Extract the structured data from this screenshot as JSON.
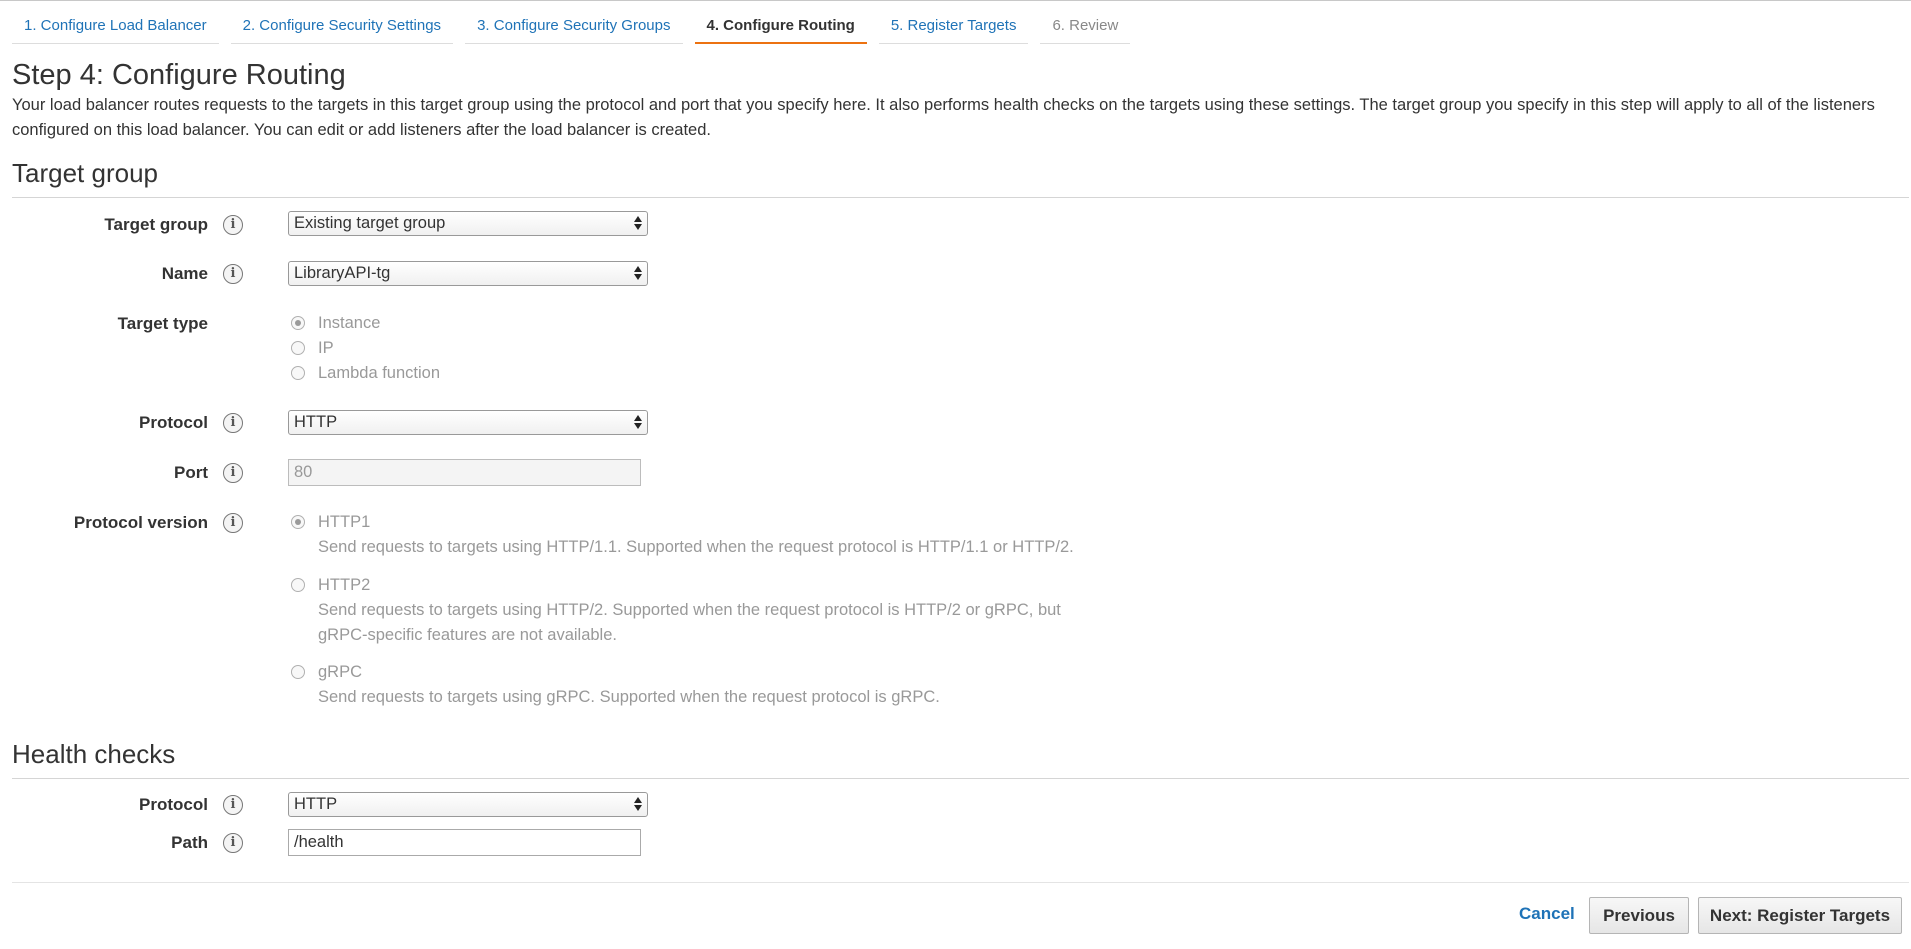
{
  "wizard": {
    "tabs": [
      {
        "label": "1. Configure Load Balancer",
        "state": "link"
      },
      {
        "label": "2. Configure Security Settings",
        "state": "link"
      },
      {
        "label": "3. Configure Security Groups",
        "state": "link"
      },
      {
        "label": "4. Configure Routing",
        "state": "active"
      },
      {
        "label": "5. Register Targets",
        "state": "link"
      },
      {
        "label": "6. Review",
        "state": "disabled"
      }
    ]
  },
  "page": {
    "title": "Step 4: Configure Routing",
    "description": "Your load balancer routes requests to the targets in this target group using the protocol and port that you specify here. It also performs health checks on the targets using these settings. The target group you specify in this step will apply to all of the listeners configured on this load balancer. You can edit or add listeners after the load balancer is created."
  },
  "target_group": {
    "section_title": "Target group",
    "target_group_label": "Target group",
    "target_group_value": "Existing target group",
    "name_label": "Name",
    "name_value": "LibraryAPI-tg",
    "target_type_label": "Target type",
    "target_type_options": [
      "Instance",
      "IP",
      "Lambda function"
    ],
    "target_type_selected": "Instance",
    "protocol_label": "Protocol",
    "protocol_value": "HTTP",
    "port_label": "Port",
    "port_value": "80",
    "protocol_version_label": "Protocol version",
    "protocol_versions": [
      {
        "label": "HTTP1",
        "help": "Send requests to targets using HTTP/1.1. Supported when the request protocol is HTTP/1.1 or HTTP/2.",
        "help2": ""
      },
      {
        "label": "HTTP2",
        "help": "Send requests to targets using HTTP/2. Supported when the request protocol is HTTP/2 or gRPC, but",
        "help2": "gRPC-specific features are not available."
      },
      {
        "label": "gRPC",
        "help": "Send requests to targets using gRPC. Supported when the request protocol is gRPC.",
        "help2": ""
      }
    ],
    "protocol_version_selected": "HTTP1"
  },
  "health_checks": {
    "section_title": "Health checks",
    "protocol_label": "Protocol",
    "protocol_value": "HTTP",
    "path_label": "Path",
    "path_value": "/health"
  },
  "footer": {
    "cancel_label": "Cancel",
    "previous_label": "Previous",
    "next_label": "Next: Register Targets"
  },
  "colors": {
    "link": "#1f73b7",
    "active_tab_underline": "#ec7211"
  },
  "icons": {
    "info": "i"
  }
}
